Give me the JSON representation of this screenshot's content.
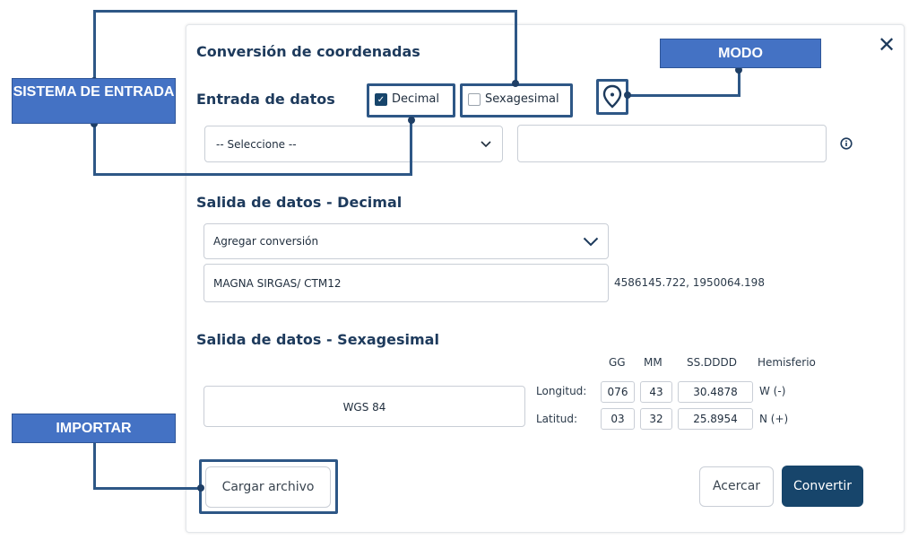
{
  "dialog": {
    "title": "Conversión de coordenadas",
    "close_label": "✕"
  },
  "input": {
    "heading": "Entrada de datos",
    "decimal_label": "Decimal",
    "decimal_checked": true,
    "sexagesimal_label": "Sexagesimal",
    "sexagesimal_checked": false,
    "system_select": "-- Seleccione --",
    "coordinates_value": "",
    "info_icon": "info-icon",
    "mode_icon": "map-pin-icon"
  },
  "output_decimal": {
    "heading": "Salida de datos - Decimal",
    "add_select": "Agregar conversión",
    "system_name": "MAGNA SIRGAS/ CTM12",
    "result": "4586145.722, 1950064.198"
  },
  "output_sexagesimal": {
    "heading": "Salida de datos - Sexagesimal",
    "columns": [
      "GG",
      "MM",
      "SS.DDDD",
      "Hemisferio"
    ],
    "system_name": "WGS 84",
    "rows": [
      {
        "label": "Longitud:",
        "gg": "076",
        "mm": "43",
        "ss": "30.4878",
        "hemi": "W (-)"
      },
      {
        "label": "Latitud:",
        "gg": "03",
        "mm": "32",
        "ss": "25.8954",
        "hemi": "N (+)"
      }
    ]
  },
  "buttons": {
    "load_file": "Cargar archivo",
    "zoom": "Acercar",
    "convert": "Convertir"
  },
  "callouts": {
    "input_system": "SISTEMA DE ENTRADA",
    "mode": "MODO",
    "import": "IMPORTAR"
  },
  "colors": {
    "primary": "#17456b",
    "callout": "#4472c4",
    "highlight": "#2e5786"
  }
}
